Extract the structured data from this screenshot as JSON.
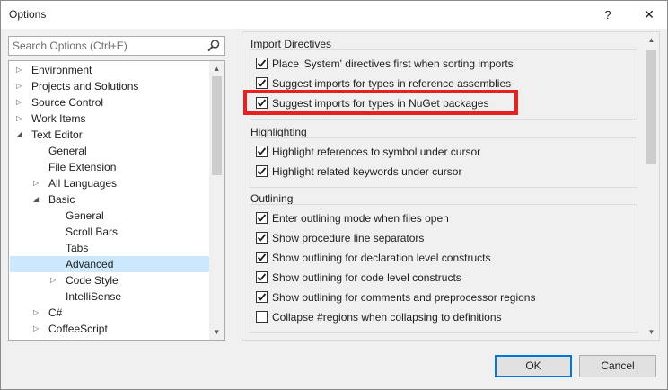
{
  "window": {
    "title": "Options",
    "help_glyph": "?",
    "close_glyph": "✕"
  },
  "search": {
    "placeholder": "Search Options (Ctrl+E)"
  },
  "tree": {
    "items": [
      {
        "label": "Environment",
        "level": 0,
        "state": "collapsed"
      },
      {
        "label": "Projects and Solutions",
        "level": 0,
        "state": "collapsed"
      },
      {
        "label": "Source Control",
        "level": 0,
        "state": "collapsed"
      },
      {
        "label": "Work Items",
        "level": 0,
        "state": "collapsed"
      },
      {
        "label": "Text Editor",
        "level": 0,
        "state": "expanded"
      },
      {
        "label": "General",
        "level": 1,
        "state": "leaf"
      },
      {
        "label": "File Extension",
        "level": 1,
        "state": "leaf"
      },
      {
        "label": "All Languages",
        "level": 1,
        "state": "collapsed"
      },
      {
        "label": "Basic",
        "level": 1,
        "state": "expanded"
      },
      {
        "label": "General",
        "level": 2,
        "state": "leaf"
      },
      {
        "label": "Scroll Bars",
        "level": 2,
        "state": "leaf"
      },
      {
        "label": "Tabs",
        "level": 2,
        "state": "leaf"
      },
      {
        "label": "Advanced",
        "level": 2,
        "state": "leaf",
        "selected": true
      },
      {
        "label": "Code Style",
        "level": 2,
        "state": "collapsed"
      },
      {
        "label": "IntelliSense",
        "level": 2,
        "state": "leaf"
      },
      {
        "label": "C#",
        "level": 1,
        "state": "collapsed"
      },
      {
        "label": "CoffeeScript",
        "level": 1,
        "state": "collapsed"
      }
    ]
  },
  "groups": [
    {
      "title": "Import Directives",
      "options": [
        {
          "label": "Place 'System' directives first when sorting imports",
          "checked": true
        },
        {
          "label": "Suggest imports for types in reference assemblies",
          "checked": true
        },
        {
          "label": "Suggest imports for types in NuGet packages",
          "checked": true
        }
      ]
    },
    {
      "title": "Highlighting",
      "options": [
        {
          "label": "Highlight references to symbol under cursor",
          "checked": true
        },
        {
          "label": "Highlight related keywords under cursor",
          "checked": true
        }
      ]
    },
    {
      "title": "Outlining",
      "options": [
        {
          "label": "Enter outlining mode when files open",
          "checked": true
        },
        {
          "label": "Show procedure line separators",
          "checked": true
        },
        {
          "label": "Show outlining for declaration level constructs",
          "checked": true
        },
        {
          "label": "Show outlining for code level constructs",
          "checked": true
        },
        {
          "label": "Show outlining for comments and preprocessor regions",
          "checked": true
        },
        {
          "label": "Collapse #regions when collapsing to definitions",
          "checked": false
        }
      ]
    }
  ],
  "buttons": {
    "ok": "OK",
    "cancel": "Cancel"
  },
  "colors": {
    "accent": "#0078d7",
    "selection": "#cce8ff",
    "annotation": "#e8211e"
  }
}
